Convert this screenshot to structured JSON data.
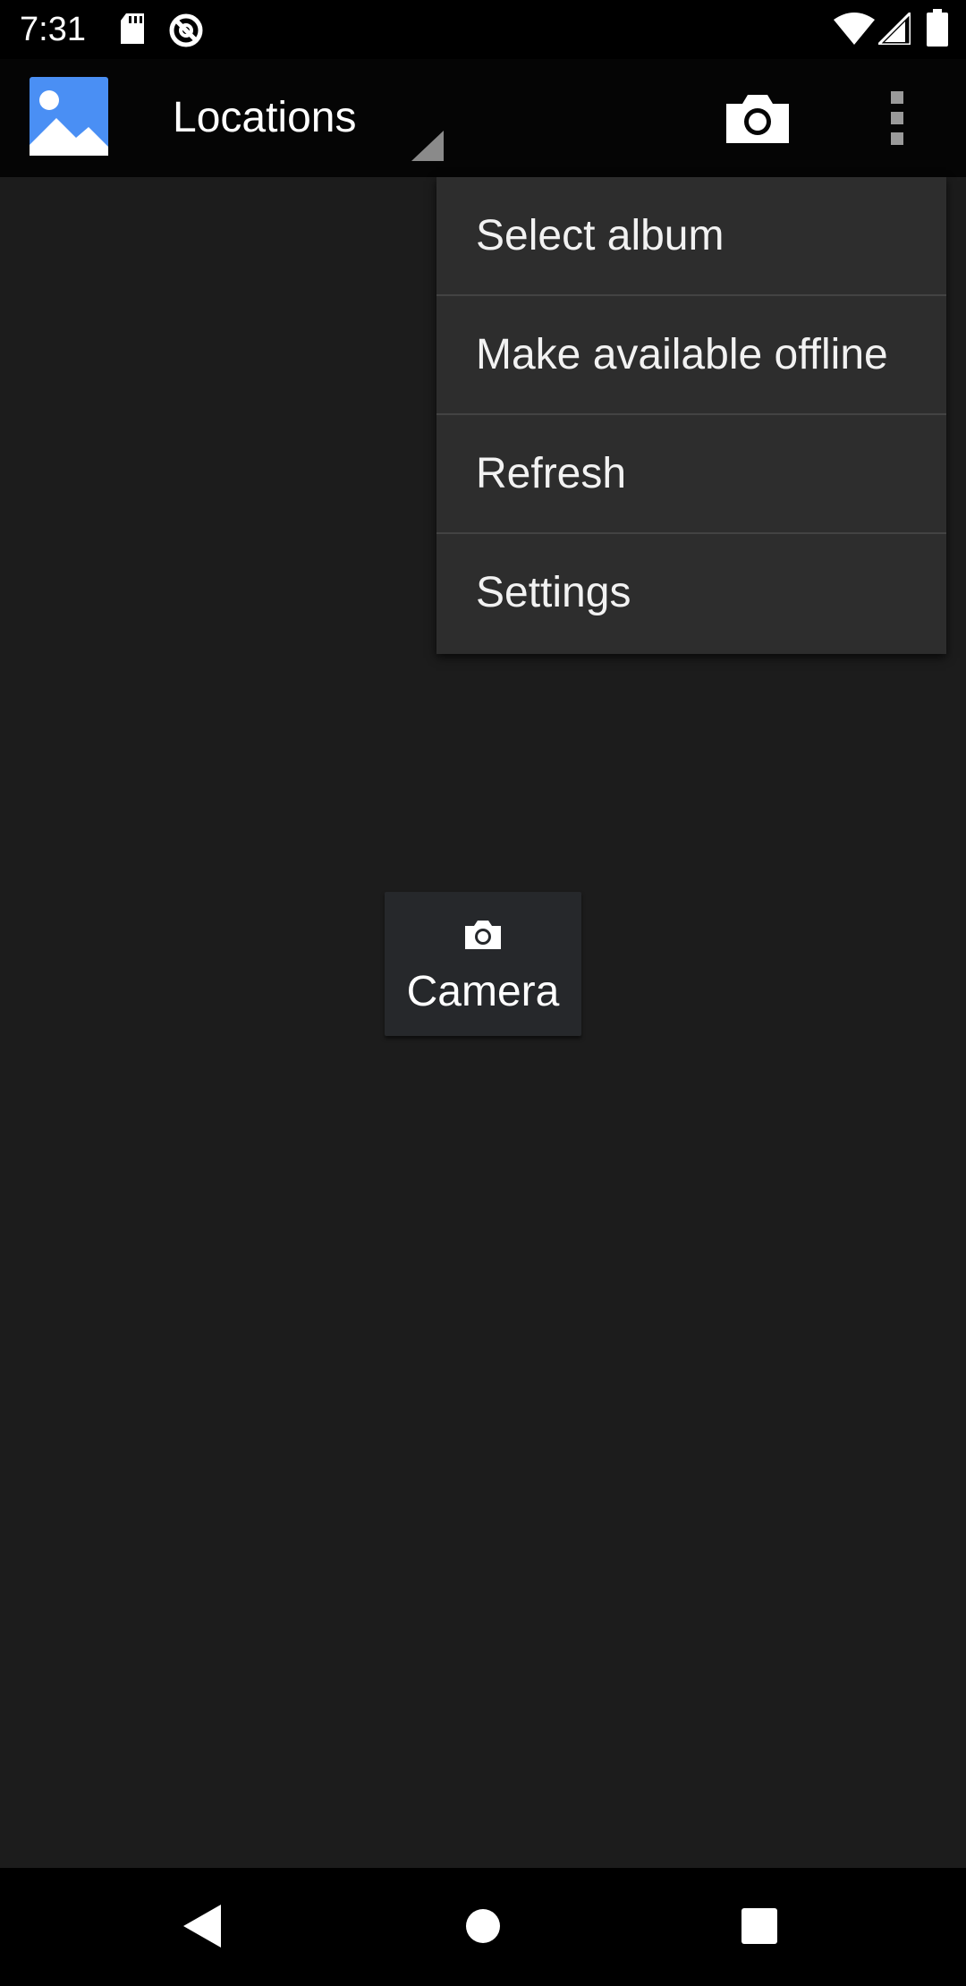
{
  "status_bar": {
    "time": "7:31",
    "left_icons": [
      "sd-card-icon",
      "at-sign-icon"
    ],
    "right_icons": [
      "wifi-icon",
      "cell-signal-icon",
      "battery-icon"
    ]
  },
  "app_bar": {
    "logo_icon": "gallery-logo-icon",
    "title": "Locations",
    "actions": [
      "camera-icon",
      "overflow-menu-icon"
    ]
  },
  "overflow_menu": {
    "items": [
      {
        "label": "Select album"
      },
      {
        "label": "Make available offline"
      },
      {
        "label": "Refresh"
      },
      {
        "label": "Settings"
      }
    ]
  },
  "content": {
    "camera_tile": {
      "icon": "camera-icon",
      "label": "Camera"
    }
  },
  "nav_bar": {
    "buttons": [
      "back-icon",
      "home-icon",
      "recents-icon"
    ]
  },
  "colors": {
    "background": "#1c1c1c",
    "app_bar": "#050505",
    "menu": "#2d2d2d",
    "logo_blue": "#4a8ff4"
  }
}
